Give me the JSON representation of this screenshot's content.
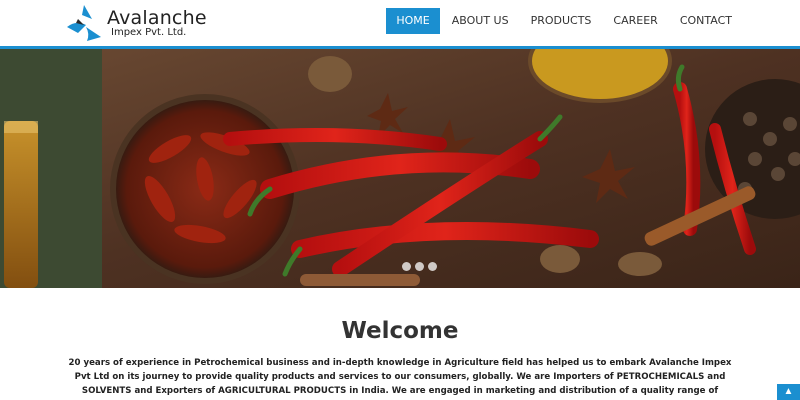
{
  "brand": {
    "name": "Avalanche",
    "sub": "Impex Pvt. Ltd.",
    "accent": "#1b8fd0"
  },
  "nav": {
    "items": [
      {
        "label": "HOME",
        "active": true
      },
      {
        "label": "ABOUT US",
        "active": false
      },
      {
        "label": "PRODUCTS",
        "active": false
      },
      {
        "label": "CAREER",
        "active": false
      },
      {
        "label": "CONTACT",
        "active": false
      }
    ]
  },
  "slider": {
    "image": "spices-and-red-chillies",
    "slides": 3,
    "active_slide": 1
  },
  "main": {
    "title": "Welcome",
    "intro": "20 years of experience in Petrochemical business and in-depth knowledge in Agriculture field has helped us to embark Avalanche Impex Pvt Ltd on its journey to provide quality products and services to our consumers, globally. We are Importers of PETROCHEMICALS and SOLVENTS and Exporters of AGRICULTURAL PRODUCTS in India. We are engaged in marketing and distribution of a quality range of Speciality Petroleum Products, Lubricant Additives etc. These are"
  },
  "scroll_top": {
    "icon": "chevron-up-icon",
    "glyph": "▲"
  }
}
